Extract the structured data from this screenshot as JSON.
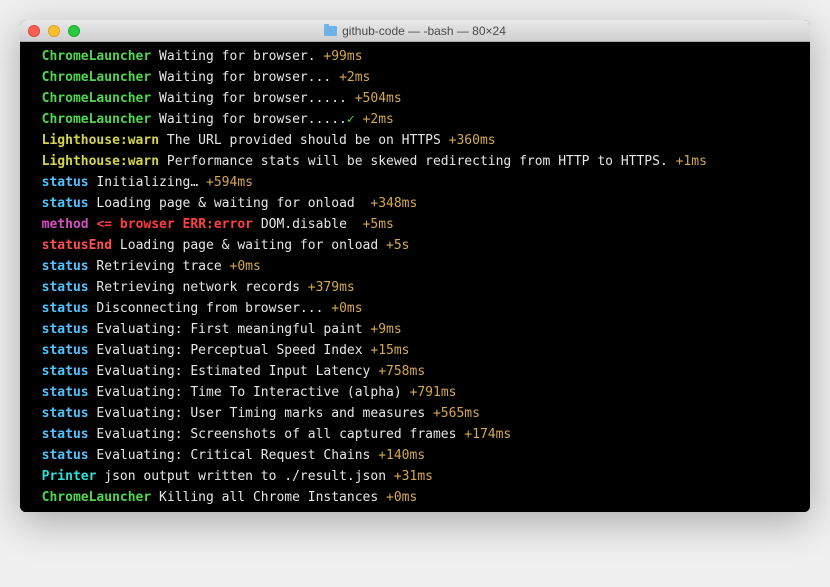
{
  "window": {
    "title": "github-code — -bash — 80×24"
  },
  "lines": [
    {
      "indent": true,
      "segments": [
        {
          "cls": "c-source-green",
          "text": "ChromeLauncher"
        },
        {
          "cls": "c-white",
          "text": " Waiting for browser. "
        },
        {
          "cls": "c-timing",
          "text": "+99ms"
        }
      ]
    },
    {
      "indent": true,
      "segments": [
        {
          "cls": "c-source-green",
          "text": "ChromeLauncher"
        },
        {
          "cls": "c-white",
          "text": " Waiting for browser... "
        },
        {
          "cls": "c-timing",
          "text": "+2ms"
        }
      ]
    },
    {
      "indent": true,
      "segments": [
        {
          "cls": "c-source-green",
          "text": "ChromeLauncher"
        },
        {
          "cls": "c-white",
          "text": " Waiting for browser..... "
        },
        {
          "cls": "c-timing",
          "text": "+504ms"
        }
      ]
    },
    {
      "indent": true,
      "segments": [
        {
          "cls": "c-source-green",
          "text": "ChromeLauncher"
        },
        {
          "cls": "c-white",
          "text": " Waiting for browser....."
        },
        {
          "cls": "c-check",
          "text": "✓"
        },
        {
          "cls": "c-white",
          "text": " "
        },
        {
          "cls": "c-timing",
          "text": "+2ms"
        }
      ]
    },
    {
      "indent": true,
      "segments": [
        {
          "cls": "c-source-yellow",
          "text": "Lighthouse:warn"
        },
        {
          "cls": "c-white",
          "text": " The URL provided should be on HTTPS "
        },
        {
          "cls": "c-timing",
          "text": "+360ms"
        }
      ]
    },
    {
      "indent": true,
      "wrap": true,
      "segments": [
        {
          "cls": "c-source-yellow",
          "text": "Lighthouse:warn"
        },
        {
          "cls": "c-white",
          "text": " Performance stats will be skewed redirecting from HTTP to HTTPS. "
        },
        {
          "cls": "c-timing",
          "text": "+1ms"
        }
      ]
    },
    {
      "indent": true,
      "segments": [
        {
          "cls": "c-sky",
          "text": "status"
        },
        {
          "cls": "c-white",
          "text": " Initializing… "
        },
        {
          "cls": "c-timing",
          "text": "+594ms"
        }
      ]
    },
    {
      "indent": true,
      "segments": [
        {
          "cls": "c-sky",
          "text": "status"
        },
        {
          "cls": "c-white",
          "text": " Loading page & waiting for onload  "
        },
        {
          "cls": "c-timing",
          "text": "+348ms"
        }
      ]
    },
    {
      "indent": true,
      "segments": [
        {
          "cls": "c-source-magenta",
          "text": "method"
        },
        {
          "cls": "c-white",
          "text": " "
        },
        {
          "cls": "c-redkw",
          "text": "<= browser"
        },
        {
          "cls": "c-white",
          "text": " "
        },
        {
          "cls": "c-errlbl",
          "text": "ERR:error"
        },
        {
          "cls": "c-white",
          "text": " DOM.disable  "
        },
        {
          "cls": "c-timing",
          "text": "+5ms"
        }
      ]
    },
    {
      "indent": true,
      "segments": [
        {
          "cls": "c-source-red",
          "text": "statusEnd"
        },
        {
          "cls": "c-white",
          "text": " Loading page & waiting for onload "
        },
        {
          "cls": "c-timing",
          "text": "+5s"
        }
      ]
    },
    {
      "indent": true,
      "segments": [
        {
          "cls": "c-sky",
          "text": "status"
        },
        {
          "cls": "c-white",
          "text": " Retrieving trace "
        },
        {
          "cls": "c-timing",
          "text": "+0ms"
        }
      ]
    },
    {
      "indent": true,
      "segments": [
        {
          "cls": "c-sky",
          "text": "status"
        },
        {
          "cls": "c-white",
          "text": " Retrieving network records "
        },
        {
          "cls": "c-timing",
          "text": "+379ms"
        }
      ]
    },
    {
      "indent": true,
      "segments": [
        {
          "cls": "c-sky",
          "text": "status"
        },
        {
          "cls": "c-white",
          "text": " Disconnecting from browser... "
        },
        {
          "cls": "c-timing",
          "text": "+0ms"
        }
      ]
    },
    {
      "indent": true,
      "segments": [
        {
          "cls": "c-sky",
          "text": "status"
        },
        {
          "cls": "c-white",
          "text": " Evaluating: First meaningful paint "
        },
        {
          "cls": "c-timing",
          "text": "+9ms"
        }
      ]
    },
    {
      "indent": true,
      "segments": [
        {
          "cls": "c-sky",
          "text": "status"
        },
        {
          "cls": "c-white",
          "text": " Evaluating: Perceptual Speed Index "
        },
        {
          "cls": "c-timing",
          "text": "+15ms"
        }
      ]
    },
    {
      "indent": true,
      "segments": [
        {
          "cls": "c-sky",
          "text": "status"
        },
        {
          "cls": "c-white",
          "text": " Evaluating: Estimated Input Latency "
        },
        {
          "cls": "c-timing",
          "text": "+758ms"
        }
      ]
    },
    {
      "indent": true,
      "segments": [
        {
          "cls": "c-sky",
          "text": "status"
        },
        {
          "cls": "c-white",
          "text": " Evaluating: Time To Interactive (alpha) "
        },
        {
          "cls": "c-timing",
          "text": "+791ms"
        }
      ]
    },
    {
      "indent": true,
      "segments": [
        {
          "cls": "c-sky",
          "text": "status"
        },
        {
          "cls": "c-white",
          "text": " Evaluating: User Timing marks and measures "
        },
        {
          "cls": "c-timing",
          "text": "+565ms"
        }
      ]
    },
    {
      "indent": true,
      "segments": [
        {
          "cls": "c-sky",
          "text": "status"
        },
        {
          "cls": "c-white",
          "text": " Evaluating: Screenshots of all captured frames "
        },
        {
          "cls": "c-timing",
          "text": "+174ms"
        }
      ]
    },
    {
      "indent": true,
      "segments": [
        {
          "cls": "c-sky",
          "text": "status"
        },
        {
          "cls": "c-white",
          "text": " Evaluating: Critical Request Chains "
        },
        {
          "cls": "c-timing",
          "text": "+140ms"
        }
      ]
    },
    {
      "indent": true,
      "segments": [
        {
          "cls": "c-source-cyan",
          "text": "Printer"
        },
        {
          "cls": "c-white",
          "text": " json output written to ./result.json "
        },
        {
          "cls": "c-timing",
          "text": "+31ms"
        }
      ]
    },
    {
      "indent": true,
      "segments": [
        {
          "cls": "c-source-green",
          "text": "ChromeLauncher"
        },
        {
          "cls": "c-white",
          "text": " Killing all Chrome Instances "
        },
        {
          "cls": "c-timing",
          "text": "+0ms"
        }
      ]
    }
  ]
}
